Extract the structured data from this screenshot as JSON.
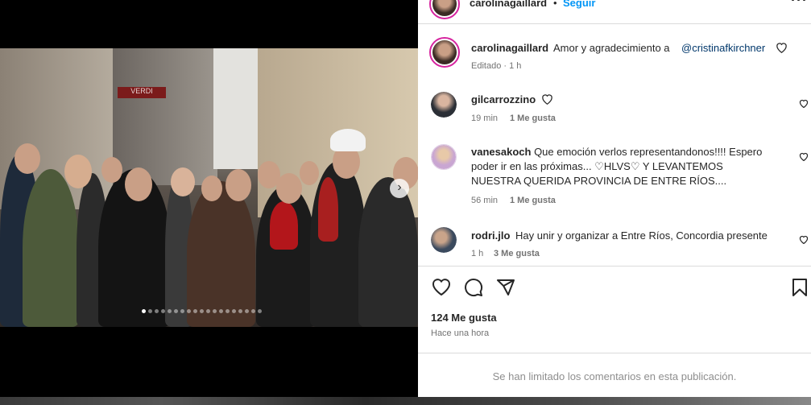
{
  "header": {
    "username": "carolinagaillard",
    "dot": "•",
    "follow_label": "Seguir",
    "more_icon": "more-horizontal-icon"
  },
  "caption": {
    "username": "carolinagaillard",
    "text": "Amor y agradecimiento a",
    "mention": "@cristinafkirchner",
    "edited": "Editado · 1 h"
  },
  "comments": [
    {
      "username": "gilcarrozzino",
      "text": "",
      "time": "19 min",
      "likes": "1 Me gusta"
    },
    {
      "username": "vanesakoch",
      "text_line1": "Que emoción verlos representandonos!!!! Espero",
      "text_line2": "poder ir en las próximas... ♡HLVS♡ Y LEVANTEMOS",
      "text_line3": "NUESTRA QUERIDA PROVINCIA DE ENTRE RÍOS....",
      "time": "56 min",
      "likes": "1 Me gusta"
    },
    {
      "username": "rodri.jlo",
      "text": "Hay unir y organizar a Entre Ríos, Concordia presente",
      "time": "1 h",
      "likes": "3 Me gusta"
    }
  ],
  "actions": {
    "like_icon": "heart-icon",
    "comment_icon": "comment-icon",
    "share_icon": "send-icon",
    "save_icon": "bookmark-icon"
  },
  "stats": {
    "likes": "124 Me gusta",
    "posted": "Hace una hora"
  },
  "footer": {
    "comments_limited": "Se han limitado los comentarios en esta publicación."
  },
  "photo": {
    "sign_text": "VERDI",
    "carousel_total": 19,
    "carousel_active": 1
  },
  "colors": {
    "accent_link": "#00376b",
    "follow_blue": "#0095f6",
    "story_ring": "#d6249f"
  }
}
